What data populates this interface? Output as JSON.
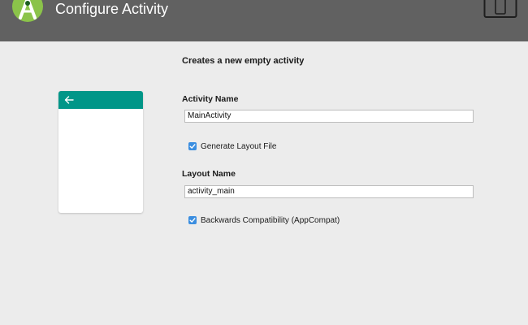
{
  "header": {
    "title": "Configure Activity",
    "logo_icon": "android-studio-logo",
    "device_icon": "tablet-phone-icon",
    "background": "#616161"
  },
  "description": "Creates a new empty activity",
  "preview": {
    "appbar_color": "#009688",
    "back_icon": "arrow-back-icon"
  },
  "form": {
    "activity_name_label": "Activity Name",
    "activity_name_value": "MainActivity",
    "generate_layout_label": "Generate Layout File",
    "generate_layout_checked": true,
    "layout_name_label": "Layout Name",
    "layout_name_value": "activity_main",
    "backwards_compat_label": "Backwards Compatibility (AppCompat)",
    "backwards_compat_checked": true
  },
  "colors": {
    "accent": "#3b8ee0",
    "page_background": "#ececec"
  }
}
